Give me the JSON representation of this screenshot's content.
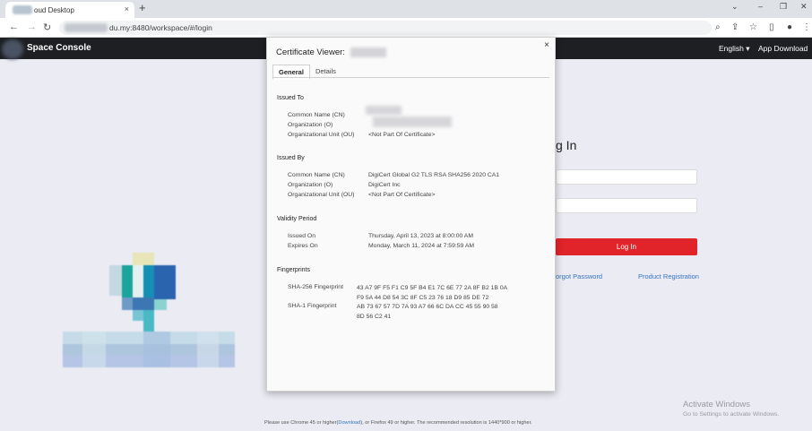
{
  "browser": {
    "tab_title": "oud Desktop",
    "tab_close": "×",
    "new_tab": "+",
    "url_visible": "du.my:8480/workspace/#/login",
    "window_controls": [
      "⌄",
      "–",
      "❐",
      "✕"
    ]
  },
  "app": {
    "title": "Space Console",
    "language": "English ▾",
    "app_download": "App Download"
  },
  "login": {
    "title": "g In",
    "button": "Log In",
    "forgot_password": "orgot Password",
    "product_registration": "Product Registration"
  },
  "footer": {
    "note_before": "Please use Chrome 45 or higher(",
    "note_link": "Download",
    "note_after": "), or Firefox 49 or higher. The recommended resolution is 1440*900 or higher."
  },
  "activate": {
    "line1": "Activate Windows",
    "line2": "Go to Settings to activate Windows."
  },
  "dialog": {
    "title": "Certificate Viewer:",
    "close": "×",
    "tabs": [
      "General",
      "Details"
    ],
    "issued_to": {
      "heading": "Issued To",
      "rows": [
        {
          "label": "Common Name (CN)",
          "value": ""
        },
        {
          "label": "Organization (O)",
          "value": ""
        },
        {
          "label": "Organizational Unit (OU)",
          "value": "<Not Part Of Certificate>"
        }
      ]
    },
    "issued_by": {
      "heading": "Issued By",
      "rows": [
        {
          "label": "Common Name (CN)",
          "value": "DigiCert Global G2 TLS RSA SHA256 2020 CA1"
        },
        {
          "label": "Organization (O)",
          "value": "DigiCert Inc"
        },
        {
          "label": "Organizational Unit (OU)",
          "value": "<Not Part Of Certificate>"
        }
      ]
    },
    "validity": {
      "heading": "Validity Period",
      "rows": [
        {
          "label": "Issued On",
          "value": "Thursday, April 13, 2023 at 8:00:00 AM"
        },
        {
          "label": "Expires On",
          "value": "Monday, March 11, 2024 at 7:59:59 AM"
        }
      ]
    },
    "fingerprints": {
      "heading": "Fingerprints",
      "sha256_label": "SHA-256 Fingerprint",
      "sha256_value": "43 A7 9F F5 F1 C9 5F B4 E1 7C 6E 77 2A 8F B2 1B 0A F9 5A 44 D8 54 3C 8F C5 23 76 18 D9 85 DE 72",
      "sha1_label": "SHA-1 Fingerprint",
      "sha1_value": "AB 73 67 57 7D 7A 93 A7 66 6C DA CC 45 55 90 58 8D 56 C2 41"
    }
  },
  "colors": {
    "appbar": "#1d1f23",
    "login_button": "#e1242a",
    "link": "#3574c3"
  }
}
